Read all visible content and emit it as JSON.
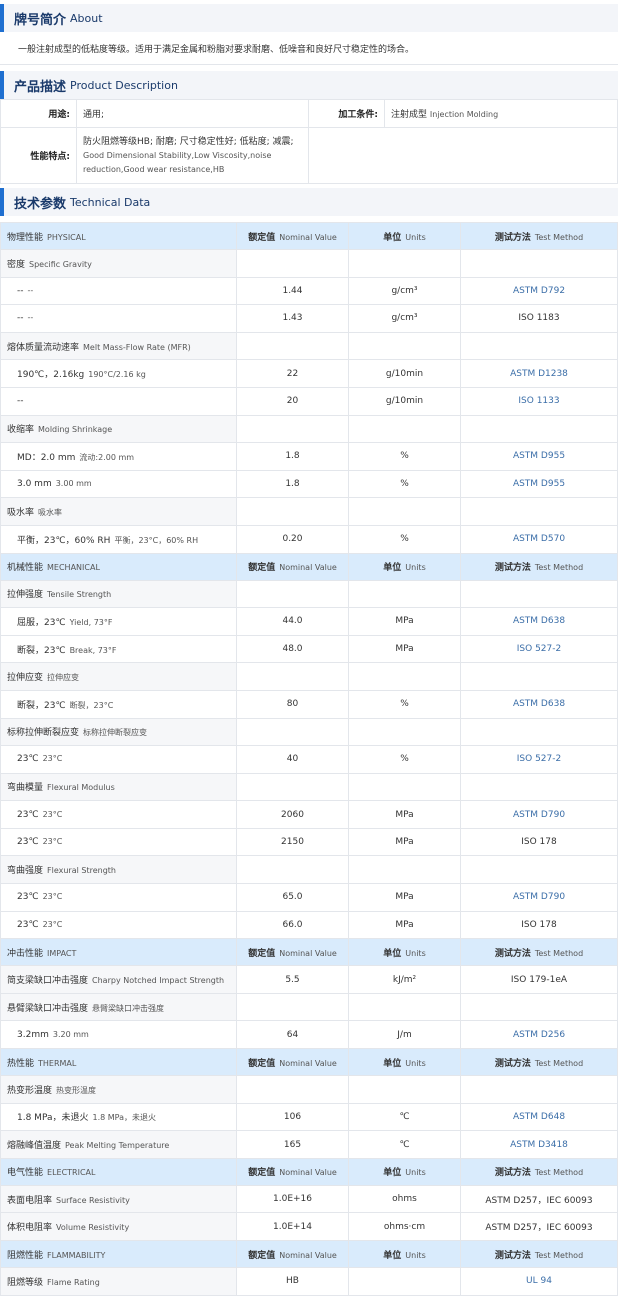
{
  "about": {
    "title_zh": "牌号简介",
    "title_en": "About",
    "text": "一般注射成型的低粘度等级。适用于满足金属和粉脂对要求耐磨、低噪音和良好尺寸稳定性的场合。"
  },
  "product": {
    "title_zh": "产品描述",
    "title_en": "Product Description",
    "usage_label": "用途:",
    "usage_value": "通用;",
    "process_label": "加工条件:",
    "process_value_zh": "注射成型",
    "process_value_en": "Injection Molding",
    "feature_label": "性能特点:",
    "feature_value_zh": "防火阻燃等级HB; 耐磨; 尺寸稳定性好; 低粘度; 减震;",
    "feature_value_en": "Good Dimensional Stability,Low Viscosity,noise reduction,Good wear resistance,HB"
  },
  "tech": {
    "title_zh": "技术参数",
    "title_en": "Technical Data",
    "header": {
      "nominal_zh": "额定值",
      "nominal_en": "Nominal Value",
      "unit_zh": "单位",
      "unit_en": "Units",
      "method_zh": "测试方法",
      "method_en": "Test Method"
    },
    "sections": [
      {
        "title_zh": "物理性能",
        "title_en": "PHYSICAL",
        "rows": [
          {
            "kind": "prop",
            "zh": "密度",
            "en": "Specific Gravity"
          },
          {
            "kind": "sub",
            "zh": "--",
            "en": "--",
            "value": "1.44",
            "unit": "g/cm³",
            "method": "ASTM D792",
            "link": true
          },
          {
            "kind": "sub",
            "zh": "--",
            "en": "--",
            "value": "1.43",
            "unit": "g/cm³",
            "method": "ISO 1183",
            "link": false
          },
          {
            "kind": "prop",
            "zh": "熔体质量流动速率",
            "en": "Melt Mass-Flow Rate (MFR)"
          },
          {
            "kind": "sub",
            "zh": "190℃，2.16kg",
            "en": "190°C/2.16 kg",
            "value": "22",
            "unit": "g/10min",
            "method": "ASTM D1238",
            "link": true
          },
          {
            "kind": "sub",
            "zh": "--",
            "en": "",
            "value": "20",
            "unit": "g/10min",
            "method": "ISO 1133",
            "link": true
          },
          {
            "kind": "prop",
            "zh": "收缩率",
            "en": "Molding Shrinkage"
          },
          {
            "kind": "sub",
            "zh": "MD：2.0 mm",
            "en": "流动:2.00 mm",
            "value": "1.8",
            "unit": "%",
            "method": "ASTM D955",
            "link": true
          },
          {
            "kind": "sub",
            "zh": "3.0 mm",
            "en": "3.00 mm",
            "value": "1.8",
            "unit": "%",
            "method": "ASTM D955",
            "link": true
          },
          {
            "kind": "prop",
            "zh": "吸水率",
            "en": "吸水率"
          },
          {
            "kind": "sub",
            "zh": "平衡，23℃，60% RH",
            "en": "平衡，23°C，60% RH",
            "value": "0.20",
            "unit": "%",
            "method": "ASTM D570",
            "link": true
          }
        ]
      },
      {
        "title_zh": "机械性能",
        "title_en": "MECHANICAL",
        "rows": [
          {
            "kind": "prop",
            "zh": "拉伸强度",
            "en": "Tensile Strength"
          },
          {
            "kind": "sub",
            "zh": "屈服，23℃",
            "en": "Yield, 73°F",
            "value": "44.0",
            "unit": "MPa",
            "method": "ASTM D638",
            "link": true
          },
          {
            "kind": "sub",
            "zh": "断裂，23℃",
            "en": "Break, 73°F",
            "value": "48.0",
            "unit": "MPa",
            "method": "ISO 527-2",
            "link": true
          },
          {
            "kind": "prop",
            "zh": "拉伸应变",
            "en": "拉伸应变"
          },
          {
            "kind": "sub",
            "zh": "断裂，23℃",
            "en": "断裂，23°C",
            "value": "80",
            "unit": "%",
            "method": "ASTM D638",
            "link": true
          },
          {
            "kind": "prop",
            "zh": "标称拉伸断裂应变",
            "en": "标称拉伸断裂应变"
          },
          {
            "kind": "sub",
            "zh": "23℃",
            "en": "23°C",
            "value": "40",
            "unit": "%",
            "method": "ISO 527-2",
            "link": true
          },
          {
            "kind": "prop",
            "zh": "弯曲模量",
            "en": "Flexural Modulus"
          },
          {
            "kind": "sub",
            "zh": "23℃",
            "en": "23°C",
            "value": "2060",
            "unit": "MPa",
            "method": "ASTM D790",
            "link": true
          },
          {
            "kind": "sub",
            "zh": "23℃",
            "en": "23°C",
            "value": "2150",
            "unit": "MPa",
            "method": "ISO 178",
            "link": false
          },
          {
            "kind": "prop",
            "zh": "弯曲强度",
            "en": "Flexural Strength"
          },
          {
            "kind": "sub",
            "zh": "23℃",
            "en": "23°C",
            "value": "65.0",
            "unit": "MPa",
            "method": "ASTM D790",
            "link": true
          },
          {
            "kind": "sub",
            "zh": "23℃",
            "en": "23°C",
            "value": "66.0",
            "unit": "MPa",
            "method": "ISO 178",
            "link": false
          }
        ]
      },
      {
        "title_zh": "冲击性能",
        "title_en": "IMPACT",
        "rows": [
          {
            "kind": "prop",
            "zh": "简支梁缺口冲击强度",
            "en": "Charpy Notched Impact Strength",
            "value": "5.5",
            "unit": "kJ/m²",
            "method": "ISO 179-1eA",
            "link": false
          },
          {
            "kind": "prop",
            "zh": "悬臂梁缺口冲击强度",
            "en": "悬臂梁缺口冲击强度"
          },
          {
            "kind": "sub",
            "zh": "3.2mm",
            "en": "3.20 mm",
            "value": "64",
            "unit": "J/m",
            "method": "ASTM D256",
            "link": true
          }
        ]
      },
      {
        "title_zh": "热性能",
        "title_en": "THERMAL",
        "rows": [
          {
            "kind": "prop",
            "zh": "热变形温度",
            "en": "热变形温度"
          },
          {
            "kind": "sub",
            "zh": "1.8 MPa，未退火",
            "en": "1.8 MPa，未退火",
            "value": "106",
            "unit": "℃",
            "method": "ASTM D648",
            "link": true
          },
          {
            "kind": "prop",
            "zh": "熔融峰值温度",
            "en": "Peak Melting Temperature",
            "value": "165",
            "unit": "℃",
            "method": "ASTM D3418",
            "link": true
          }
        ]
      },
      {
        "title_zh": "电气性能",
        "title_en": "ELECTRICAL",
        "rows": [
          {
            "kind": "prop",
            "zh": "表面电阻率",
            "en": "Surface Resistivity",
            "value": "1.0E+16",
            "unit": "ohms",
            "method": "ASTM D257，IEC 60093",
            "link": false
          },
          {
            "kind": "prop",
            "zh": "体积电阻率",
            "en": "Volume Resistivity",
            "value": "1.0E+14",
            "unit": "ohms·cm",
            "method": "ASTM D257，IEC 60093",
            "link": false
          }
        ]
      },
      {
        "title_zh": "阻燃性能",
        "title_en": "FLAMMABILITY",
        "rows": [
          {
            "kind": "prop",
            "zh": "阻燃等级",
            "en": "Flame Rating",
            "value": "HB",
            "unit": "",
            "method": "UL 94",
            "link": true
          }
        ]
      }
    ]
  }
}
